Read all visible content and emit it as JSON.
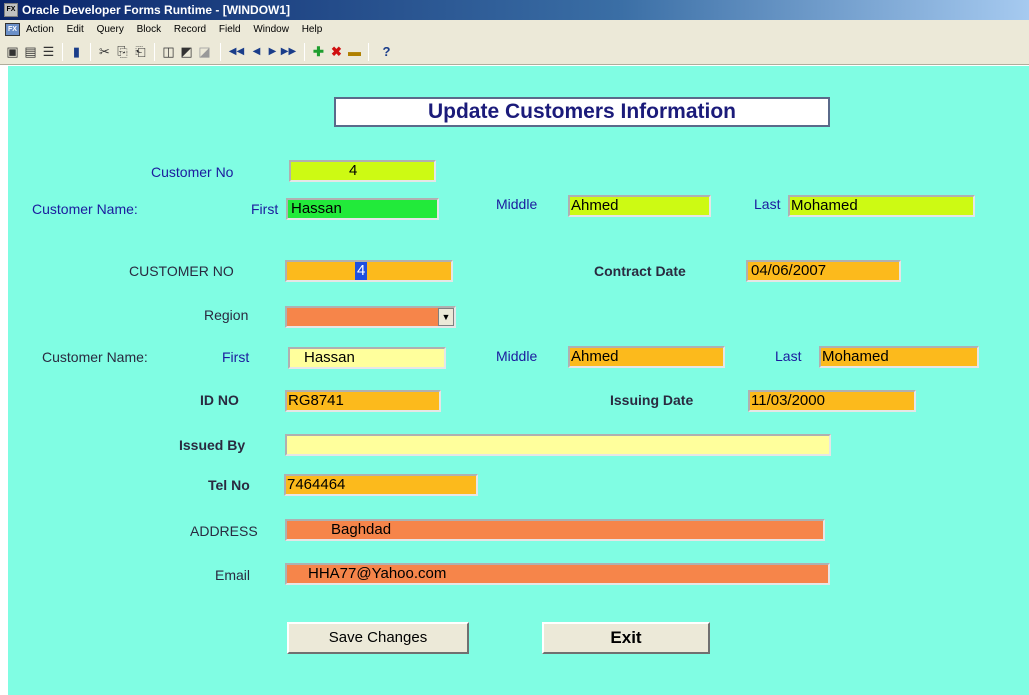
{
  "window": {
    "title": "Oracle Developer Forms Runtime - [WINDOW1]",
    "app_icon": "oracle-forms-icon"
  },
  "menu": {
    "items": [
      "Action",
      "Edit",
      "Query",
      "Block",
      "Record",
      "Field",
      "Window",
      "Help"
    ]
  },
  "toolbar": {
    "icons": [
      "save-icon",
      "print-icon",
      "print-setup-icon",
      "exit-icon",
      "cut-icon",
      "copy-icon",
      "paste-icon",
      "enter-query-icon",
      "execute-query-icon",
      "cancel-query-icon",
      "first-record-icon",
      "previous-record-icon",
      "next-record-icon",
      "last-record-icon",
      "insert-record-icon",
      "delete-record-icon",
      "lock-record-icon",
      "help-icon"
    ]
  },
  "form": {
    "title": "Update Customers Information",
    "background": "#80fde3",
    "search": {
      "customer_no_label": "Customer No",
      "customer_no_value": "4",
      "name_label": "Customer Name:",
      "first_label": "First",
      "first_value": "Hassan",
      "middle_label": "Middle",
      "middle_value": "Ahmed",
      "last_label": "Last",
      "last_value": "Mohamed"
    },
    "detail": {
      "customer_no_label": "CUSTOMER NO",
      "customer_no_value": "4",
      "contract_date_label": "Contract Date",
      "contract_date_value": "04/06/2007",
      "region_label": "Region",
      "region_value": "",
      "name_label": "Customer Name:",
      "first_label": "First",
      "first_value": "Hassan",
      "middle_label": "Middle",
      "middle_value": "Ahmed",
      "last_label": "Last",
      "last_value": "Mohamed",
      "id_no_label": "ID NO",
      "id_no_value": "RG8741",
      "issuing_date_label": "Issuing Date",
      "issuing_date_value": "11/03/2000",
      "issued_by_label": "Issued By",
      "issued_by_value": "",
      "tel_no_label": "Tel No",
      "tel_no_value": "7464464",
      "address_label": "ADDRESS",
      "address_value": "Baghdad",
      "email_label": "Email",
      "email_value": "HHA77@Yahoo.com"
    },
    "buttons": {
      "save_label": "Save Changes",
      "exit_label": "Exit"
    }
  },
  "colors": {
    "canvas": "#80fde3",
    "lime_field": "#cdfa13",
    "green_field": "#22ea3a",
    "orange_field": "#fcba1c",
    "salmon_field": "#f6854a",
    "yellow_field": "#ffff9c",
    "label_blue": "#1b1b9e"
  }
}
